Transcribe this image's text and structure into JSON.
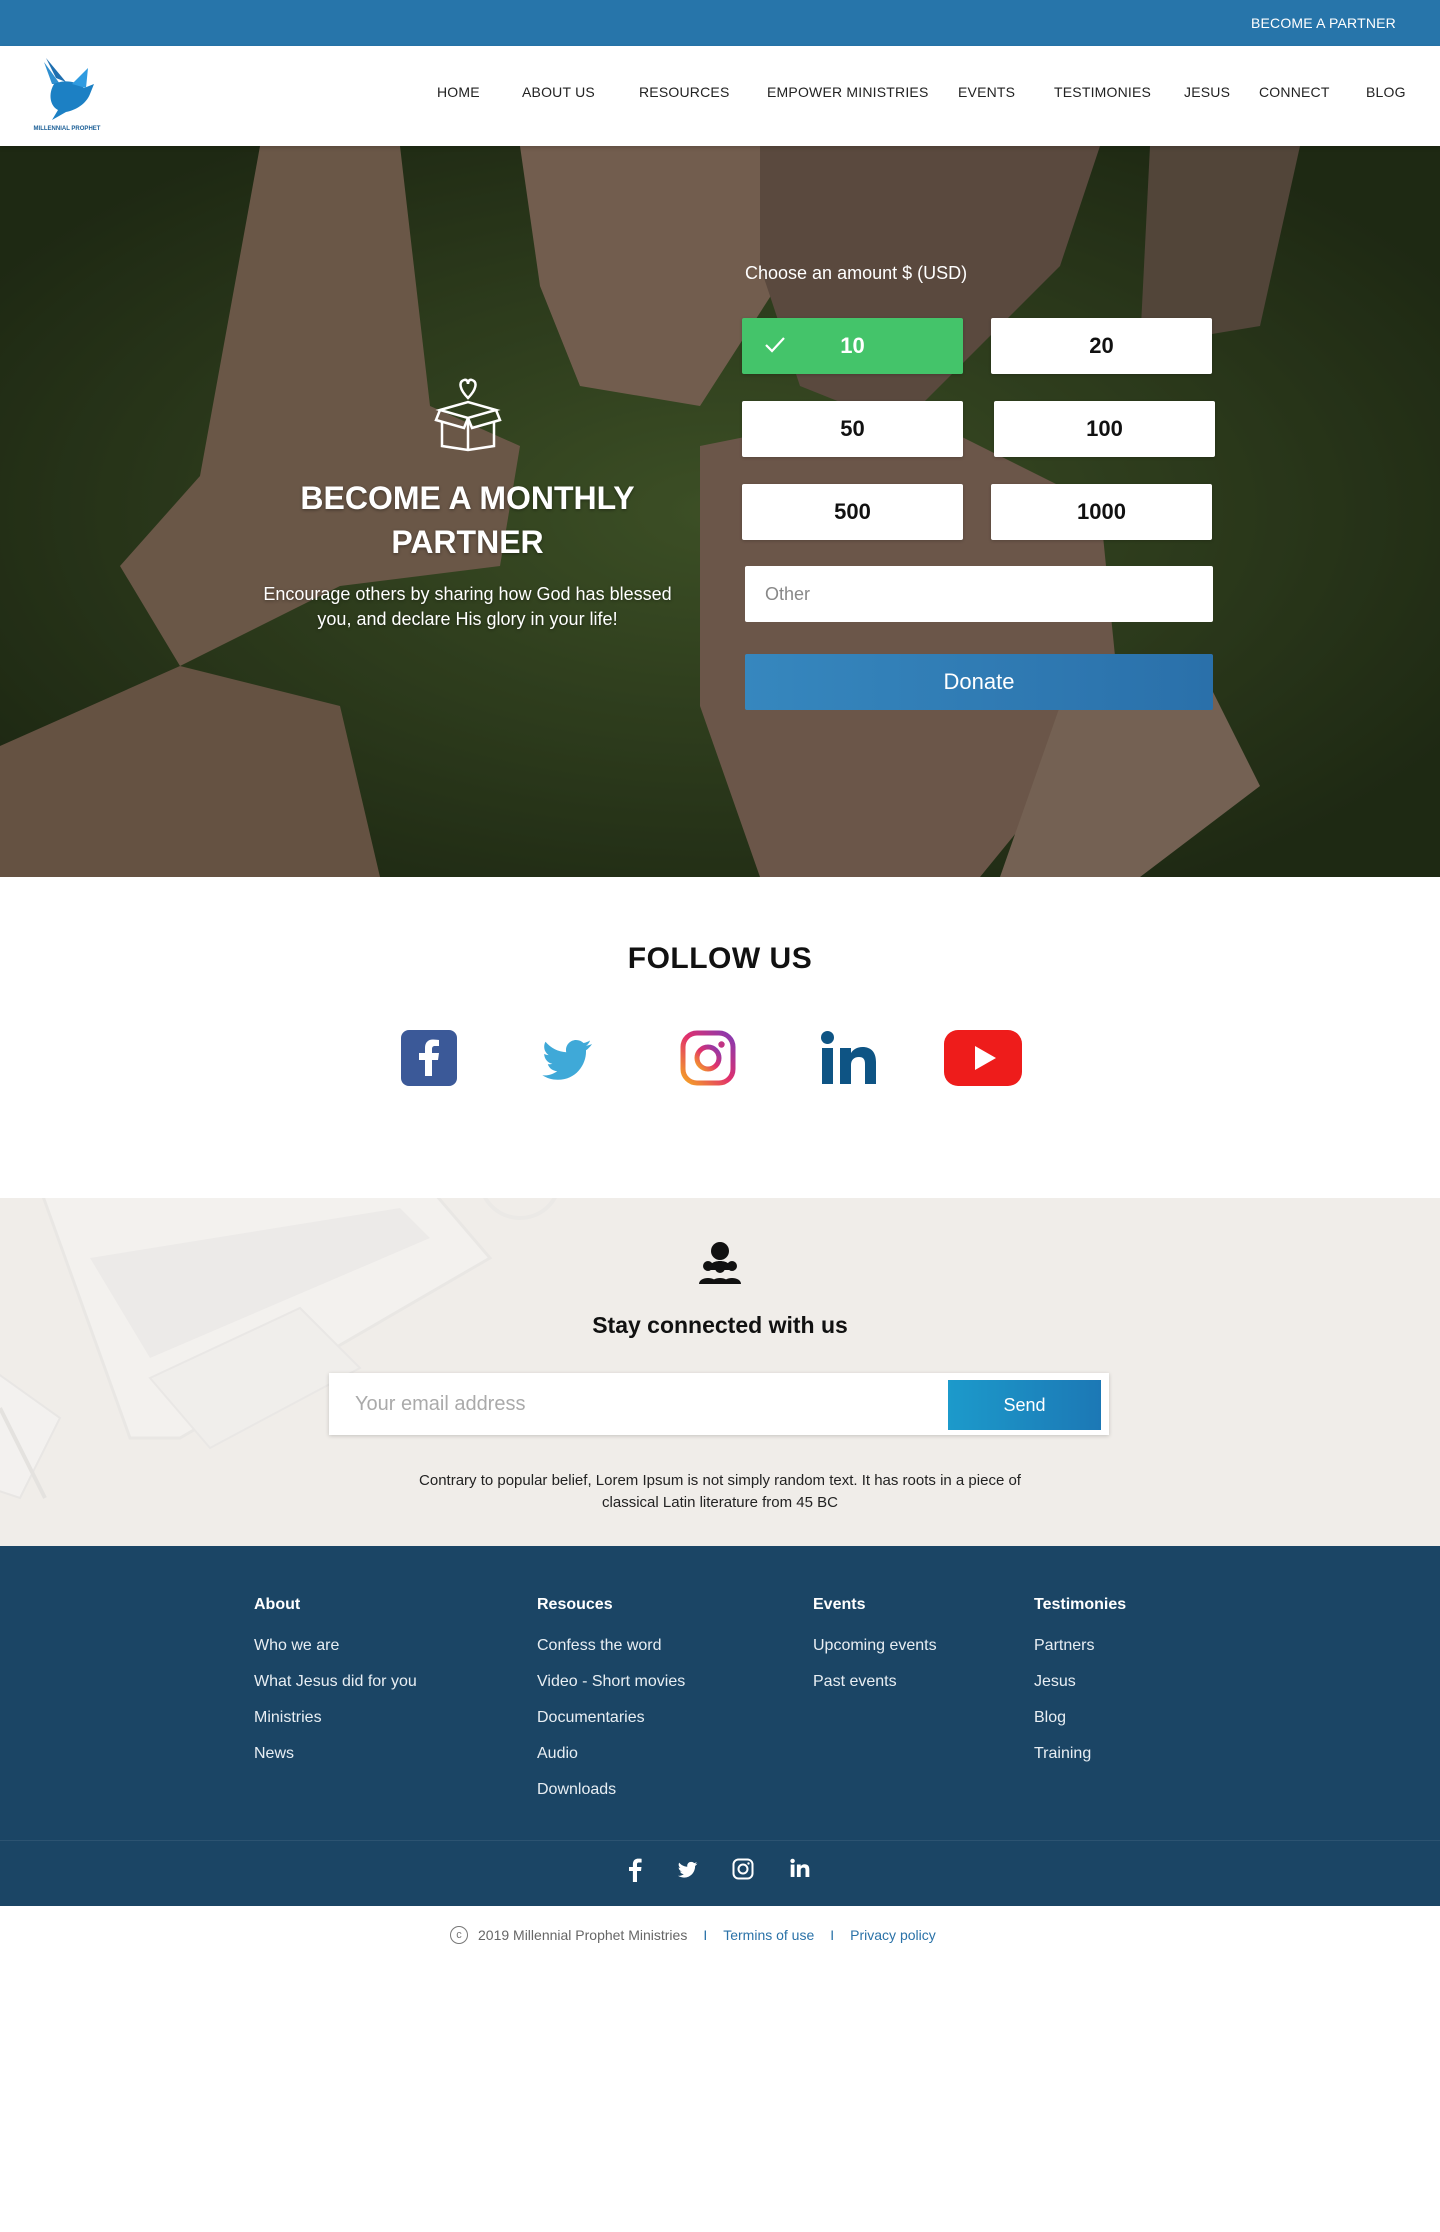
{
  "topbar": {
    "partner_link": "BECOME A PARTNER"
  },
  "brand": {
    "logo_text": "MILLENNIAL PROPHET",
    "accent": "#2775aa"
  },
  "nav": {
    "items": [
      "HOME",
      "ABOUT US",
      "RESOURCES",
      "EMPOWER MINISTRIES",
      "EVENTS",
      "TESTIMONIES",
      "JESUS",
      "CONNECT",
      "BLOG"
    ]
  },
  "hero": {
    "title": "BECOME A MONTHLY PARTNER",
    "text": "Encourage others by sharing how God has blessed you, and declare His glory in your life!",
    "amount_label": "Choose an amount $ (USD)",
    "amounts": [
      "10",
      "20",
      "50",
      "100",
      "500",
      "1000"
    ],
    "selected_amount": "10",
    "selected_color": "#44c46a",
    "other_placeholder": "Other",
    "donate_label": "Donate"
  },
  "follow": {
    "title": "FOLLOW US",
    "icons": [
      "facebook-icon",
      "twitter-icon",
      "instagram-icon",
      "linkedin-icon",
      "youtube-icon"
    ]
  },
  "newsletter": {
    "title": "Stay connected with us",
    "email_placeholder": "Your email address",
    "send_label": "Send",
    "description": "Contrary to popular belief, Lorem Ipsum is not simply random text. It has roots in a piece of classical Latin literature from 45 BC"
  },
  "footer": {
    "columns": [
      {
        "heading": "About",
        "links": [
          "Who we are",
          "What Jesus did for you",
          "Ministries",
          "News"
        ]
      },
      {
        "heading": "Resouces",
        "links": [
          "Confess the word",
          "Video - Short movies",
          "Documentaries",
          "Audio",
          "Downloads"
        ]
      },
      {
        "heading": "Events",
        "links": [
          "Upcoming events",
          "Past events"
        ]
      },
      {
        "heading": "Testimonies",
        "links": [
          "Partners",
          "Jesus",
          "Blog",
          "Training"
        ]
      }
    ],
    "social_icons": [
      "facebook-icon",
      "twitter-icon",
      "instagram-icon",
      "linkedin-icon"
    ],
    "background": "#1b4565"
  },
  "bottom": {
    "copyright_symbol": "c",
    "copyright": "2019 Millennial Prophet Ministries",
    "separator": "I",
    "terms": "Termins of use",
    "privacy": "Privacy policy"
  }
}
